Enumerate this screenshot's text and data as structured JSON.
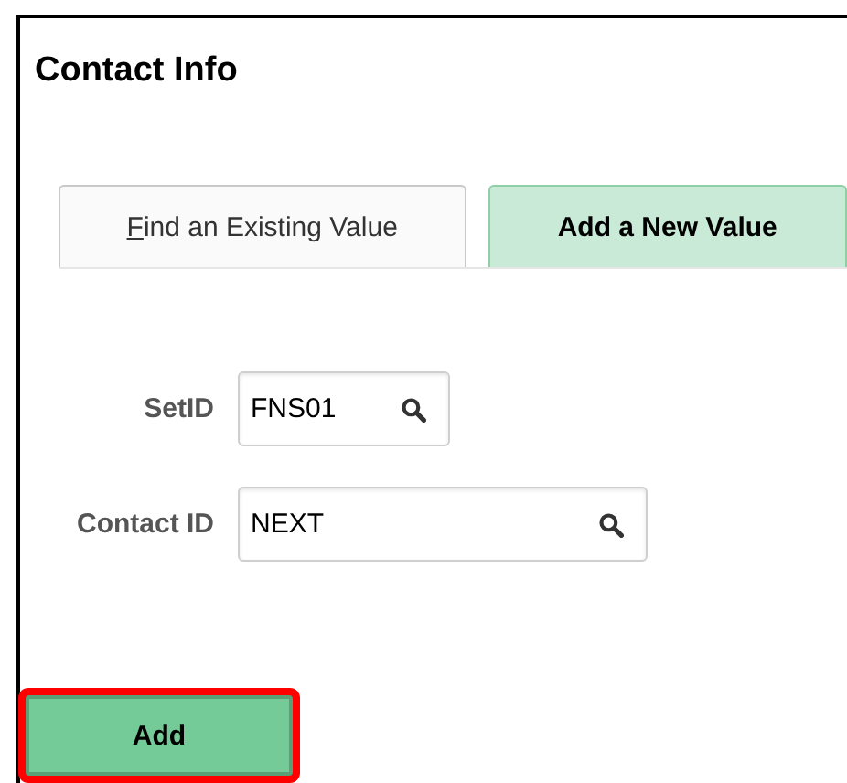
{
  "page": {
    "title": "Contact Info"
  },
  "tabs": [
    {
      "label": "Find an Existing Value",
      "selected": false
    },
    {
      "label": "Add a New Value",
      "selected": true
    }
  ],
  "fields": [
    {
      "label": "SetID",
      "value": "FNS01",
      "kind": "short"
    },
    {
      "label": "Contact ID",
      "value": "NEXT",
      "kind": "long"
    }
  ],
  "add_button": {
    "label": "Add",
    "highlighted": true
  }
}
